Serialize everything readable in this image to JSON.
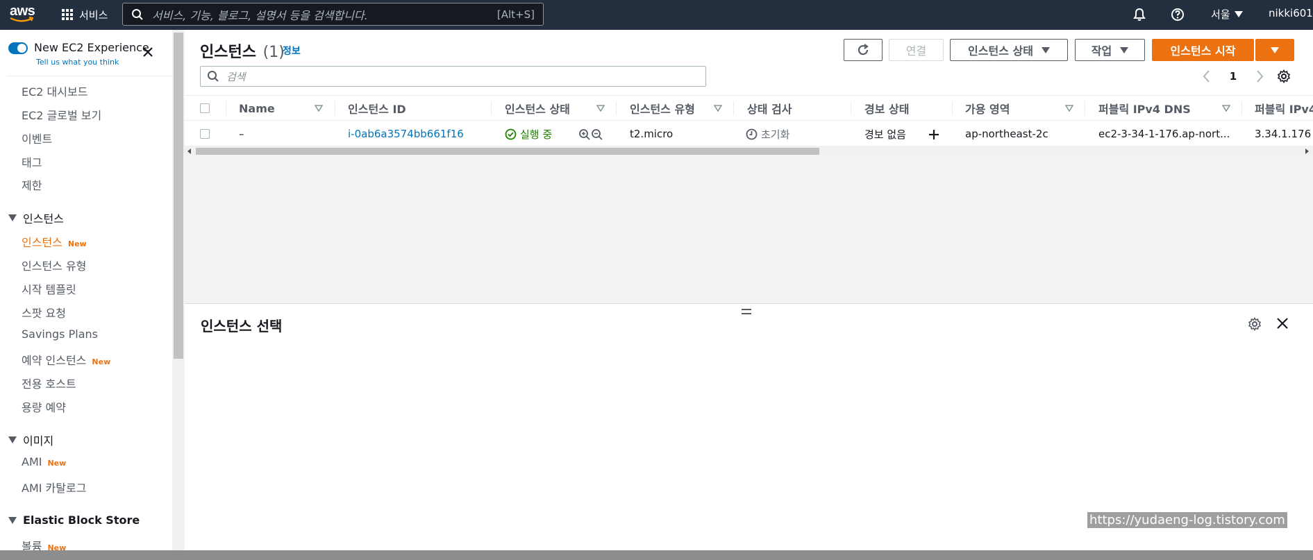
{
  "topnav": {
    "logo_text": "aws",
    "services_label": "서비스",
    "search_placeholder": "서비스, 기능, 블로그, 설명서 등을 검색합니다.",
    "search_shortcut": "[Alt+S]",
    "region": "서울",
    "user": "nikki601"
  },
  "sidebar": {
    "new_experience_label": "New EC2 Experience",
    "feedback_link": "Tell us what you think",
    "items_top": [
      "EC2 대시보드",
      "EC2 글로벌 보기",
      "이벤트",
      "태그",
      "제한"
    ],
    "group_instances": "인스턴스",
    "instances_items": [
      {
        "label": "인스턴스",
        "badge": "New"
      },
      {
        "label": "인스턴스 유형",
        "badge": ""
      },
      {
        "label": "시작 템플릿",
        "badge": ""
      },
      {
        "label": "스팟 요청",
        "badge": ""
      },
      {
        "label": "Savings Plans",
        "badge": ""
      },
      {
        "label": "예약 인스턴스",
        "badge": "New"
      },
      {
        "label": "전용 호스트",
        "badge": ""
      },
      {
        "label": "용량 예약",
        "badge": ""
      }
    ],
    "group_images": "이미지",
    "images_items": [
      {
        "label": "AMI",
        "badge": "New"
      },
      {
        "label": "AMI 카탈로그",
        "badge": ""
      }
    ],
    "group_ebs": "Elastic Block Store",
    "ebs_items": [
      {
        "label": "볼륨",
        "badge": "New"
      }
    ]
  },
  "main": {
    "title": "인스턴스",
    "count": "(1)",
    "info": "정보",
    "buttons": {
      "connect": "연결",
      "instance_state": "인스턴스 상태",
      "actions": "작업",
      "launch": "인스턴스 시작"
    },
    "filter_placeholder": "검색",
    "page": "1"
  },
  "table": {
    "columns": [
      "Name",
      "인스턴스 ID",
      "인스턴스 상태",
      "인스턴스 유형",
      "상태 검사",
      "경보 상태",
      "가용 영역",
      "퍼블릭 IPv4 DNS",
      "퍼블릭 IPv4"
    ],
    "rows": [
      {
        "name": "–",
        "instance_id": "i-0ab6a3574bb661f16",
        "state": "실행 중",
        "type": "t2.micro",
        "status_check": "초기화",
        "alarm": "경보 없음",
        "az": "ap-northeast-2c",
        "dns": "ec2-3-34-1-176.ap-nort...",
        "ip": "3.34.1.176"
      }
    ]
  },
  "detail": {
    "title": "인스턴스 선택"
  },
  "watermark": "https://yudaeng-log.tistory.com",
  "colors": {
    "nav": "#232f3e",
    "accent": "#ec7211",
    "link": "#0073bb",
    "success": "#1d8102"
  }
}
